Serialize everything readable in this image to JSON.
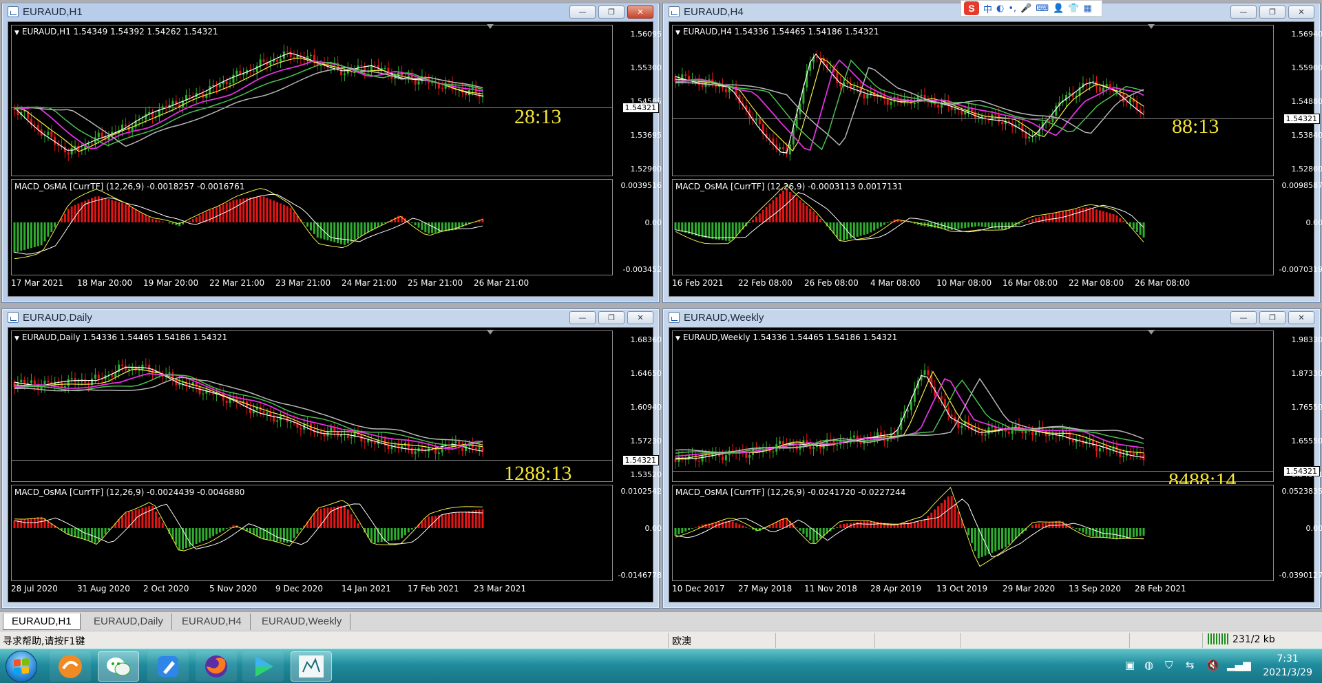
{
  "ime": {
    "logo": "S",
    "labels": [
      "中",
      "◐",
      "•,",
      "🎤",
      "⌨",
      "👤",
      "👕",
      "▦"
    ]
  },
  "windows": [
    {
      "id": "h1",
      "title": "EURAUD,H1",
      "symbar": "EURAUD,H1  1.54349 1.54392 1.54262 1.54321",
      "macd": "MACD_OsMA [CurrTF] (12,26,9) -0.0018257 -0.0016761",
      "price_axis": [
        "1.56095",
        "1.55300",
        "1.54505",
        "1.53695",
        "1.52900"
      ],
      "price_tag": "1.54321",
      "macd_axis": [
        "0.0039516",
        "0.00",
        "-0.003452"
      ],
      "timer": "28:13",
      "dates": [
        "17 Mar 2021",
        "18 Mar 20:00",
        "19 Mar 20:00",
        "22 Mar 21:00",
        "23 Mar 21:00",
        "24 Mar 21:00",
        "25 Mar 21:00",
        "26 Mar 21:00"
      ],
      "controls": {
        "min": "—",
        "max": "❐",
        "close": "✕"
      }
    },
    {
      "id": "h4",
      "title": "EURAUD,H4",
      "symbar": "EURAUD,H4  1.54336 1.54465 1.54186 1.54321",
      "macd": "MACD_OsMA [CurrTF] (12,26,9) -0.0003113 0.0017131",
      "price_axis": [
        "1.56940",
        "1.55900",
        "1.54880",
        "1.53840",
        "1.52800"
      ],
      "price_tag": "1.54321",
      "macd_axis": [
        "0.0098587",
        "0.00",
        "-0.0070319"
      ],
      "timer": "88:13",
      "dates": [
        "16 Feb 2021",
        "22 Feb 08:00",
        "26 Feb 08:00",
        "4 Mar 08:00",
        "10 Mar 08:00",
        "16 Mar 08:00",
        "22 Mar 08:00",
        "26 Mar 08:00"
      ],
      "controls": {
        "min": "—",
        "max": "❐",
        "close": "✕"
      }
    },
    {
      "id": "d1",
      "title": "EURAUD,Daily",
      "symbar": "EURAUD,Daily  1.54336 1.54465 1.54186 1.54321",
      "macd": "MACD_OsMA [CurrTF] (12,26,9) -0.0024439 -0.0046880",
      "price_axis": [
        "1.68360",
        "1.64650",
        "1.60940",
        "1.57230",
        "1.53520"
      ],
      "price_tag": "1.54321",
      "macd_axis": [
        "0.0102542",
        "0.00",
        "-0.0146778"
      ],
      "timer": "1288:13",
      "dates": [
        "28 Jul 2020",
        "31 Aug 2020",
        "2 Oct 2020",
        "5 Nov 2020",
        "9 Dec 2020",
        "14 Jan 2021",
        "17 Feb 2021",
        "23 Mar 2021"
      ],
      "controls": {
        "min": "—",
        "max": "❐",
        "close": "✕"
      }
    },
    {
      "id": "w1",
      "title": "EURAUD,Weekly",
      "symbar": "EURAUD,Weekly  1.54336 1.54465 1.54186 1.54321",
      "macd": "MACD_OsMA [CurrTF] (12,26,9) -0.0241720 -0.0227244",
      "price_axis": [
        "1.98330",
        "1.87330",
        "1.76550",
        "1.65550",
        "1.54321"
      ],
      "price_tag": "1.54321",
      "macd_axis": [
        "0.0523835",
        "0.00",
        "-0.0390127"
      ],
      "timer": "8488:14",
      "dates": [
        "10 Dec 2017",
        "27 May 2018",
        "11 Nov 2018",
        "28 Apr 2019",
        "13 Oct 2019",
        "29 Mar 2020",
        "13 Sep 2020",
        "28 Feb 2021"
      ],
      "controls": {
        "min": "—",
        "max": "❐",
        "close": "✕"
      }
    }
  ],
  "tabs": [
    "EURAUD,H1",
    "EURAUD,Daily",
    "EURAUD,H4",
    "EURAUD,Weekly"
  ],
  "status": {
    "help": "寻求帮助,请按F1键",
    "profile": "欧澳",
    "traffic": "231/2 kb"
  },
  "clock": {
    "time": "7:31",
    "date": "2021/3/29"
  },
  "colors": {
    "bull": "#2fae2f",
    "bear": "#e31515",
    "ma_fast": "#ffffff",
    "ma_yellow": "#f4ee4a",
    "ma_magenta": "#e231e2",
    "ma_green": "#49c24f",
    "ma_gray": "#b6b6b6",
    "timer": "#f5e632"
  }
}
